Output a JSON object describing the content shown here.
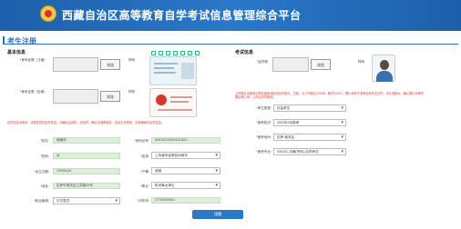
{
  "header": {
    "title": "西藏自治区高等教育自学考试信息管理综合平台"
  },
  "page": {
    "title": "考生注册"
  },
  "basic": {
    "title": "基本信息",
    "id_front_label": "*身份证照（正面）",
    "id_back_label": "*身份证照（反面）",
    "upload_label": "浏览",
    "sample_label": "样例",
    "tool_label": "裁剪照片",
    "warning": "证件信息请填写，请核实您的证件信息，请确认后按时，请及时，确认无误再保存，信息无法修改，请准确填写证件信息。"
  },
  "exam": {
    "title": "考试信息",
    "photo_label": "*证件照",
    "upload_label": "浏览",
    "sample_label": "样例",
    "warning": "上传照片请使用近期正面免冠彩色证件照片，白底，大小不超过200KB，格式为JPG。照片将用于准考证和毕业证书，请认真核对，确认照片清晰完整后再上传，上传后请勿修改。"
  },
  "form_left": [
    {
      "label": "*姓名:",
      "value": "格桑央"
    },
    {
      "label": "*性别:",
      "value": "女"
    },
    {
      "label": "*出生日期:",
      "value": "19990415"
    },
    {
      "label": "*地址:",
      "value": "拉萨市城关区江苏路26号"
    }
  ],
  "political": {
    "label": "*政治面貌:",
    "value": "中共党员"
  },
  "form_mid": [
    {
      "label": "*身份证号:",
      "value": "540102199904154821"
    },
    {
      "label": "*民族:",
      "value": "上传身份证照自动填写"
    },
    {
      "label": "*户籍:",
      "value": "城镇"
    },
    {
      "label": "*职业:",
      "value": "机关事业单位"
    },
    {
      "label": "*手机号:",
      "value": "17708900901"
    }
  ],
  "form_right": [
    {
      "label": "*考生类型:",
      "value": "社会考生"
    },
    {
      "label": "*报考批次:",
      "value": "2022年4月报考"
    },
    {
      "label": "*报考地州:",
      "value": "拉萨-城关区"
    },
    {
      "label": "*报考专业:",
      "value": "030101-法律(专科)-自学考试"
    }
  ],
  "submit": {
    "label": "注册"
  },
  "colors": {
    "primary": "#2a78c8",
    "field_bg": "#dcefd9",
    "warning": "#d9362b"
  }
}
